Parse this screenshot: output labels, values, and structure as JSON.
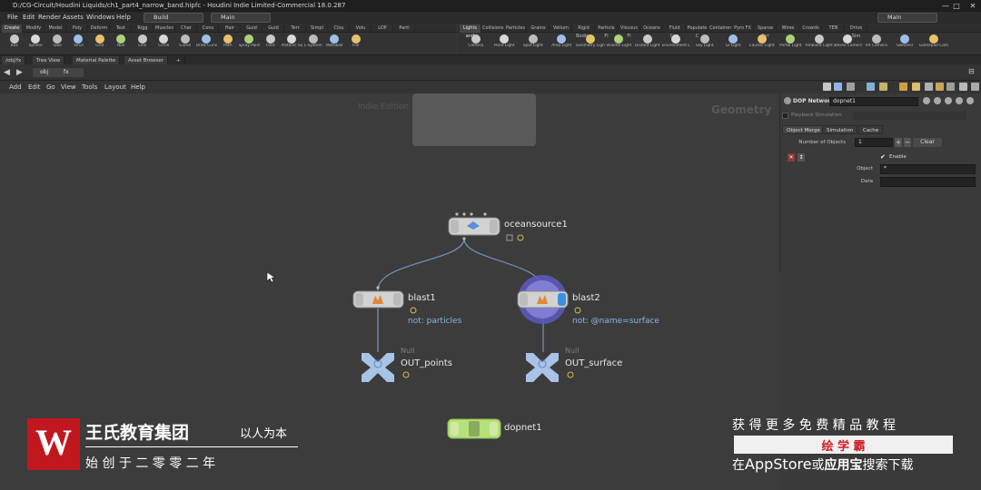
{
  "window": {
    "title": "D:/CG-Circuit/Houdini Liquids/ch1_part4_narrow_band.hipfc - Houdini Indie Limited-Commercial 18.0.287",
    "buttons": [
      "—",
      "□",
      "✕"
    ]
  },
  "menubar": {
    "items": [
      "File",
      "Edit",
      "Render",
      "Assets",
      "Windows",
      "Help"
    ],
    "desktop_left": "Build",
    "desktop_mid": "Main",
    "desktop_right": "Main"
  },
  "shelf_left": {
    "tabs": [
      "Create",
      "Modify",
      "Model",
      "Poly",
      "Deform",
      "Text",
      "Rigg",
      "Muscles",
      "Char",
      "Cons",
      "Hair",
      "Guid",
      "Guid",
      "Terr",
      "Simpl",
      "Clou",
      "Volu",
      "LOP",
      "Parti"
    ],
    "tools": [
      "Box",
      "Sphere",
      "Tube",
      "Torus",
      "Grid",
      "Null",
      "Line",
      "Circle",
      "Curve",
      "Draw Curve",
      "Path",
      "Spray Paint",
      "Font",
      "Platonic Solids",
      "L-System",
      "Metaball",
      "File"
    ]
  },
  "shelf_right": {
    "tabs": [
      "Lights and",
      "Collisions",
      "Particles",
      "Grains",
      "Vellum",
      "Rigid Bodies",
      "Particle Fl",
      "Viscous Fl",
      "Oceans",
      "Fluid Con",
      "Populate C",
      "Container",
      "Pyro FX",
      "Sparse Pyr",
      "Wires",
      "Crowds",
      "TEN",
      "Drive Sim"
    ],
    "tools": [
      "Camera",
      "Point Light",
      "Spot Light",
      "Area Light",
      "Geometry Light",
      "Volume Light",
      "Distant Light",
      "Environment Light",
      "Sky Light",
      "GI Light",
      "Caustic Light",
      "Portal Light",
      "Ambient Light",
      "Stereo Camera",
      "VR Camera",
      "Switcher",
      "Gamepad Camera"
    ]
  },
  "pane_tabs": [
    "/obj/fx",
    "Tree View",
    "Material Palette",
    "Asset Browser",
    "+"
  ],
  "pathbar": {
    "segments": [
      "obj",
      "fx"
    ]
  },
  "network_menu": [
    "Add",
    "Edit",
    "Go",
    "View",
    "Tools",
    "Layout",
    "Help"
  ],
  "network": {
    "watermark_left": "Indie Edition",
    "watermark_right": "Geometry",
    "nodes": [
      {
        "id": "oceansource1",
        "label": "oceansource1",
        "sub": "",
        "type": ""
      },
      {
        "id": "blast1",
        "label": "blast1",
        "sub": "not: particles",
        "type": ""
      },
      {
        "id": "blast2",
        "label": "blast2",
        "sub": "not: @name=surface",
        "type": ""
      },
      {
        "id": "out_points",
        "label": "OUT_points",
        "sub": "",
        "type": "Null"
      },
      {
        "id": "out_surface",
        "label": "OUT_surface",
        "sub": "",
        "type": "Null"
      },
      {
        "id": "dopnet1",
        "label": "dopnet1",
        "sub": "",
        "type": ""
      }
    ]
  },
  "params": {
    "type_label": "DOP Network",
    "node_name": "dopnet1",
    "playback": "Playback Simulation",
    "tabs": [
      "Object Merge",
      "Simulation",
      "Cache"
    ],
    "num_objects_label": "Number of Objects",
    "num_objects_value": "1",
    "clear_label": "Clear",
    "enable_label": "Enable",
    "object_label": "Object",
    "object_value": "*",
    "data_label": "Data",
    "data_value": ""
  },
  "watermark": {
    "logo_letter": "W",
    "org_name": "王氏教育集团",
    "motto": "以人为本",
    "since": "始 创 于 二 零 零 二 年",
    "promo_top": "获 得 更 多 免 费 精 品 教 程",
    "promo_brand": "绘 学 霸",
    "promo_bottom_prefix": "在",
    "promo_appstore": "AppStore",
    "promo_or": "或",
    "promo_app": "应用宝",
    "promo_suffix": "搜索下载"
  },
  "colors": {
    "network_bg": "#3c3c3c",
    "wire": "#6f8fb8",
    "node_body": "#d0d0d0",
    "selected_ring": "#6a5fc7",
    "dop_green": "#a8d870",
    "logo_red": "#c1171f"
  }
}
